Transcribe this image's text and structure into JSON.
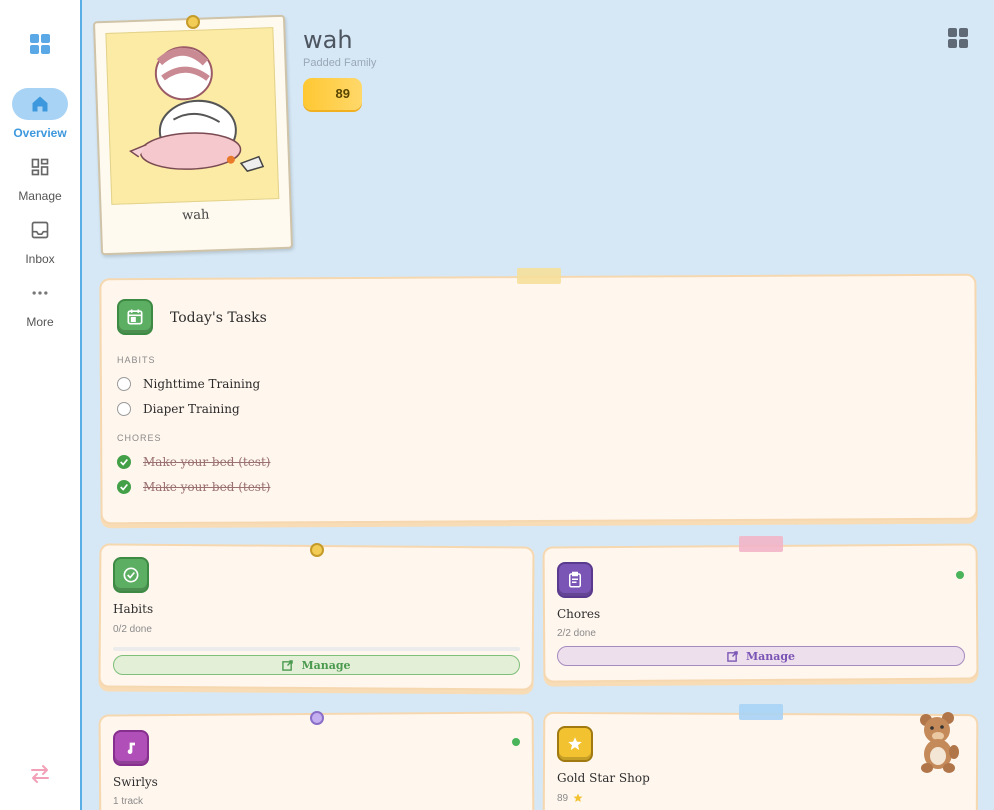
{
  "sidebar": {
    "items": [
      {
        "label": "Overview",
        "icon": "home-icon",
        "active": true
      },
      {
        "label": "Manage",
        "icon": "dashboard-icon",
        "active": false
      },
      {
        "label": "Inbox",
        "icon": "inbox-icon",
        "active": false
      },
      {
        "label": "More",
        "icon": "more-dots-icon",
        "active": false
      }
    ],
    "switch_icon": "swap-arrows-icon"
  },
  "profile": {
    "name": "wah",
    "family": "Padded Family",
    "points": "89",
    "photo_caption": "wah"
  },
  "today_tasks": {
    "title": "Today's Tasks",
    "habits_label": "HABITS",
    "habits": [
      {
        "text": "Nighttime Training",
        "done": false
      },
      {
        "text": "Diaper Training",
        "done": false
      }
    ],
    "chores_label": "CHORES",
    "chores": [
      {
        "text": "Make your bed (test)",
        "done": true
      },
      {
        "text": "Make your bed (test)",
        "done": true
      }
    ]
  },
  "habits_card": {
    "title": "Habits",
    "sub": "0/2 done",
    "progress": 0,
    "button": "Manage"
  },
  "chores_card": {
    "title": "Chores",
    "sub": "2/2 done",
    "button": "Manage"
  },
  "swirlys_card": {
    "title": "Swirlys",
    "sub": "1 track"
  },
  "shop_card": {
    "title": "Gold Star Shop",
    "sub": "89"
  },
  "colors": {
    "accent": "#5aaee8",
    "green": "#43a047",
    "purple": "#7b55b5",
    "gold": "#f2c230"
  }
}
